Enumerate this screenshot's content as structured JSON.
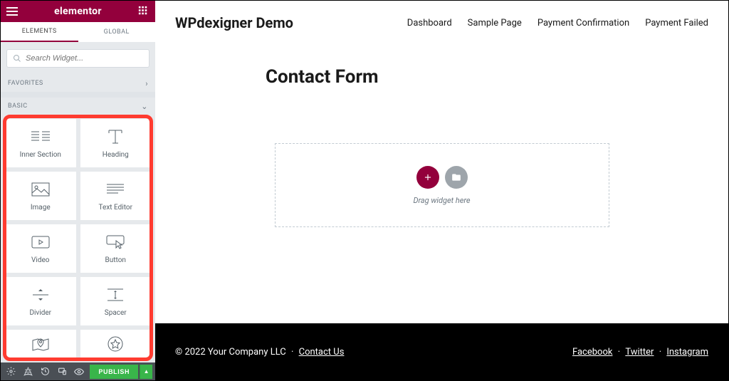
{
  "sidebar": {
    "brand": "elementor",
    "tabs": {
      "elements": "ELEMENTS",
      "global": "GLOBAL"
    },
    "search_placeholder": "Search Widget...",
    "sections": {
      "favorites": "FAVORITES",
      "basic": "BASIC"
    },
    "widgets": [
      {
        "id": "inner-section",
        "label": "Inner Section"
      },
      {
        "id": "heading",
        "label": "Heading"
      },
      {
        "id": "image",
        "label": "Image"
      },
      {
        "id": "text-editor",
        "label": "Text Editor"
      },
      {
        "id": "video",
        "label": "Video"
      },
      {
        "id": "button",
        "label": "Button"
      },
      {
        "id": "divider",
        "label": "Divider"
      },
      {
        "id": "spacer",
        "label": "Spacer"
      },
      {
        "id": "google-maps",
        "label": ""
      },
      {
        "id": "icon",
        "label": ""
      }
    ],
    "footer": {
      "publish": "PUBLISH"
    }
  },
  "site": {
    "title": "WPdexigner Demo",
    "nav": [
      "Dashboard",
      "Sample Page",
      "Payment Confirmation",
      "Payment Failed"
    ]
  },
  "page": {
    "title": "Contact Form",
    "dropzone_hint": "Drag widget here"
  },
  "footer": {
    "copyright": "© 2022 Your Company LLC",
    "contact": "Contact Us",
    "social": [
      "Facebook",
      "Twitter",
      "Instagram"
    ]
  }
}
